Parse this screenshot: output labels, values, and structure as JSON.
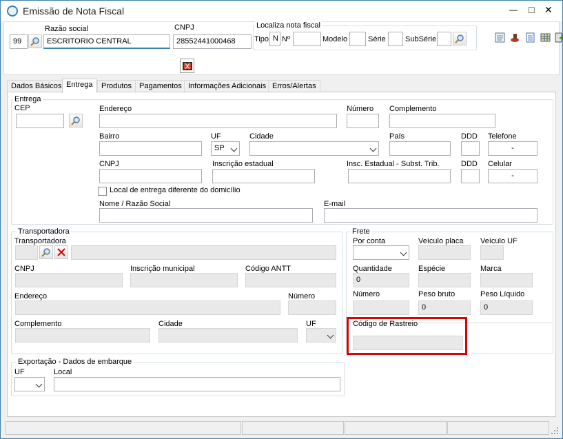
{
  "window": {
    "title": "Emissão de Nota Fiscal",
    "controls": {
      "minimize": "—",
      "maximize": "□",
      "close": "✕"
    },
    "accent": "#3c7fb1"
  },
  "header": {
    "company_code": "99",
    "razao_label": "Razão social",
    "razao_value": "ESCRITORIO CENTRAL",
    "cnpj_label": "CNPJ",
    "cnpj_value": "28552441000468",
    "localiza": {
      "title": "Localiza nota fiscal",
      "tipo_label": "Tipo",
      "tipo_value": "N",
      "numero_label": "Nº",
      "modelo_label": "Modelo",
      "serie_label": "Série",
      "subserie_label": "SubSérie"
    }
  },
  "tabs": [
    "Dados Básicos",
    "Entrega",
    "Produtos",
    "Pagamentos",
    "Informações Adicionais",
    "Erros/Alertas"
  ],
  "active_tab": "Entrega",
  "entrega": {
    "title": "Entrega",
    "cep": "CEP",
    "endereco": "Endereço",
    "numero": "Número",
    "complemento": "Complemento",
    "bairro": "Bairro",
    "uf": "UF",
    "uf_value": "SP",
    "cidade": "Cidade",
    "pais": "País",
    "ddd": "DDD",
    "telefone": "Telefone",
    "telefone_value": "-",
    "cnpj": "CNPJ",
    "ie": "Inscrição estadual",
    "ie_st": "Insc. Estadual - Subst. Trib.",
    "ddd2": "DDD",
    "celular": "Celular",
    "celular_value": "-",
    "checkbox_label": "Local de entrega diferente do domicílio",
    "nome": "Nome / Razão Social",
    "email": "E-mail"
  },
  "transportadora": {
    "title": "Transportadora",
    "label": "Transportadora",
    "cnpj": "CNPJ",
    "im": "Inscrição municipal",
    "antt": "Código ANTT",
    "endereco": "Endereço",
    "numero": "Número",
    "complemento": "Complemento",
    "cidade": "Cidade",
    "uf": "UF"
  },
  "frete": {
    "title": "Frete",
    "por_conta": "Por conta",
    "veiculo_placa": "Veículo placa",
    "veiculo_uf": "Veículo UF",
    "quantidade": "Quantidade",
    "quantidade_value": "0",
    "especie": "Espécie",
    "marca": "Marca",
    "numero": "Número",
    "peso_bruto": "Peso bruto",
    "peso_bruto_value": "0",
    "peso_liquido": "Peso Líquido",
    "peso_liquido_value": "0",
    "rastreio": "Código de Rastreio",
    "highlight_color": "#e00000"
  },
  "exportacao": {
    "title": "Exportação - Dados de embarque",
    "uf": "UF",
    "local": "Local"
  }
}
